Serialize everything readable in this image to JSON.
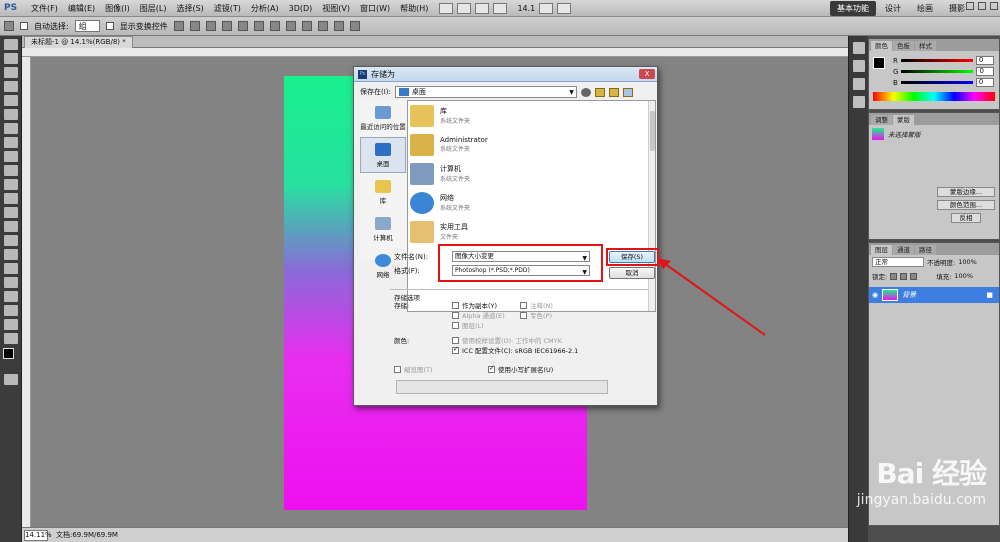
{
  "app": {
    "logo": "PS",
    "menu": [
      "文件(F)",
      "编辑(E)",
      "图像(I)",
      "图层(L)",
      "选择(S)",
      "滤镜(T)",
      "分析(A)",
      "3D(D)",
      "视图(V)",
      "窗口(W)",
      "帮助(H)"
    ],
    "zoom_value": "14.1",
    "workspaces": [
      "基本功能",
      "设计",
      "绘画",
      "摄影"
    ]
  },
  "options_bar": {
    "auto_select_label": "自动选择:",
    "auto_select_value": "组",
    "show_transform_label": "显示变换控件"
  },
  "document": {
    "tab_label": "未标题-1 @ 14.1%(RGB/8) *",
    "status_zoom": "14.11%",
    "status_doc": "文档:69.9M/69.9M"
  },
  "colors": {
    "gradient_top": "#19f08e",
    "gradient_bottom": "#ee10f0",
    "highlight_red": "#e01414",
    "selected_layer_bg": "#3d7ee0"
  },
  "panels": {
    "color_tabs": [
      "颜色",
      "色板",
      "样式"
    ],
    "rgb_values": [
      {
        "channel": "R",
        "value": "0"
      },
      {
        "channel": "G",
        "value": "0"
      },
      {
        "channel": "B",
        "value": "0"
      }
    ],
    "adjust_tabs": [
      "调整",
      "蒙版"
    ],
    "mask_label": "未选择蒙版",
    "mask_buttons": [
      "蒙版边缘...",
      "颜色范围...",
      "反相"
    ],
    "layer_tabs": [
      "图层",
      "通道",
      "路径"
    ],
    "blend_mode": "正常",
    "opacity_label": "不透明度:",
    "opacity_value": "100%",
    "lock_label": "锁定:",
    "fill_label": "填充:",
    "fill_value": "100%",
    "layer_name": "背景"
  },
  "dialog": {
    "title": "存储为",
    "close": "X",
    "save_in_label": "保存在(I):",
    "save_in_value": "桌面",
    "places": [
      {
        "label": "最近访问的位置",
        "icon": "recent-places-icon"
      },
      {
        "label": "桌面",
        "icon": "desktop-icon"
      },
      {
        "label": "库",
        "icon": "library-icon"
      },
      {
        "label": "计算机",
        "icon": "computer-icon"
      },
      {
        "label": "网络",
        "icon": "network-icon"
      }
    ],
    "files": [
      {
        "name": "库",
        "type": "系统文件夹",
        "icon": "library-folder-icon"
      },
      {
        "name": "Administrator",
        "type": "系统文件夹",
        "icon": "user-folder-icon"
      },
      {
        "name": "计算机",
        "type": "系统文件夹",
        "icon": "computer-icon"
      },
      {
        "name": "网络",
        "type": "系统文件夹",
        "icon": "network-icon"
      },
      {
        "name": "实用工具",
        "type": "文件夹",
        "icon": "folder-icon"
      }
    ],
    "filename_label": "文件名(N):",
    "filename_value": "图像大小变更",
    "format_label": "格式(F):",
    "format_value": "Photoshop (*.PSD;*.PDD)",
    "save_button": "保存(S)",
    "cancel_button": "取消",
    "options_title": "存储选项",
    "store_label": "存储:",
    "as_copy": "作为副本(Y)",
    "notes": "注释(N)",
    "alpha": "Alpha 通道(E)",
    "spot": "专色(P)",
    "layers": "图层(L)",
    "color_label": "颜色:",
    "proof_setup": "使用校样设置(O): 工作中的 CMYK",
    "icc_profile": "ICC 配置文件(C): sRGB IEC61966-2.1",
    "thumbnail": "缩览图(T)",
    "lowercase_ext": "使用小写扩展名(U)"
  },
  "watermark": {
    "main": "Bai 经验",
    "sub": "jingyan.baidu.com"
  }
}
